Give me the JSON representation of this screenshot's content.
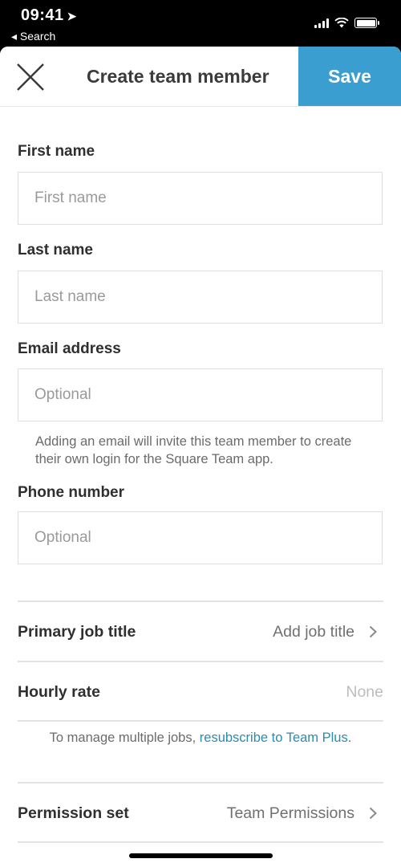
{
  "status_bar": {
    "time": "09:41",
    "location_icon": "location-arrow-icon",
    "back_label": "◂ Search",
    "icons": [
      "cellular-signal-icon",
      "wifi-icon",
      "battery-icon"
    ]
  },
  "header": {
    "close_icon": "close-icon",
    "title": "Create team member",
    "save_label": "Save",
    "accent_color": "#3a9fd0"
  },
  "form": {
    "first_name": {
      "label": "First name",
      "placeholder": "First name",
      "value": ""
    },
    "last_name": {
      "label": "Last name",
      "placeholder": "Last name",
      "value": ""
    },
    "email": {
      "label": "Email address",
      "placeholder": "Optional",
      "value": "",
      "help": "Adding an email will invite this team member to create their own login for the Square Team app."
    },
    "phone": {
      "label": "Phone number",
      "placeholder": "Optional",
      "value": ""
    }
  },
  "settings": {
    "job_title": {
      "label": "Primary job title",
      "value": "Add job title"
    },
    "hourly_rate": {
      "label": "Hourly rate",
      "value": "None"
    },
    "note_prefix": "To manage multiple jobs, ",
    "note_link": "resubscribe to Team Plus",
    "note_suffix": ".",
    "link_color": "#2b8bb0",
    "permission_set": {
      "label": "Permission set",
      "value": "Team Permissions"
    }
  }
}
